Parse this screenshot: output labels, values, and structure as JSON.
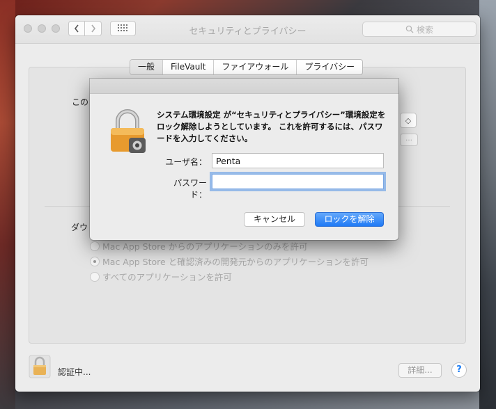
{
  "window": {
    "title": "セキュリティとプライバシー",
    "search_placeholder": "検索"
  },
  "tabs": [
    {
      "label": "一般",
      "selected": true
    },
    {
      "label": "FileVault",
      "selected": false
    },
    {
      "label": "ファイアウォール",
      "selected": false
    },
    {
      "label": "プライバシー",
      "selected": false
    }
  ],
  "background": {
    "partial_label_1": "この",
    "partial_label_2": "ダウ",
    "popup_glyph": "◇",
    "ellipsis_button": "…",
    "radio_options": [
      {
        "label": "Mac App Store からのアプリケーションのみを許可",
        "selected": false
      },
      {
        "label": "Mac App Store と確認済みの開発元からのアプリケーションを許可",
        "selected": true
      },
      {
        "label": "すべてのアプリケーションを許可",
        "selected": false
      }
    ]
  },
  "footer": {
    "status": "認証中...",
    "detail_button": "詳細...",
    "help_button": "?"
  },
  "dialog": {
    "message": "システム環境設定 が“セキュリティとプライバシー”環境設定をロック解除しようとしています。 これを許可するには、パスワードを入力してください。",
    "username_label": "ユーザ名：",
    "username_value": "Penta",
    "password_label": "パスワード：",
    "password_value": "",
    "cancel_button": "キャンセル",
    "unlock_button": "ロックを解除"
  },
  "colors": {
    "accent": "#1f7af5",
    "focus_ring": "#5091e6"
  }
}
